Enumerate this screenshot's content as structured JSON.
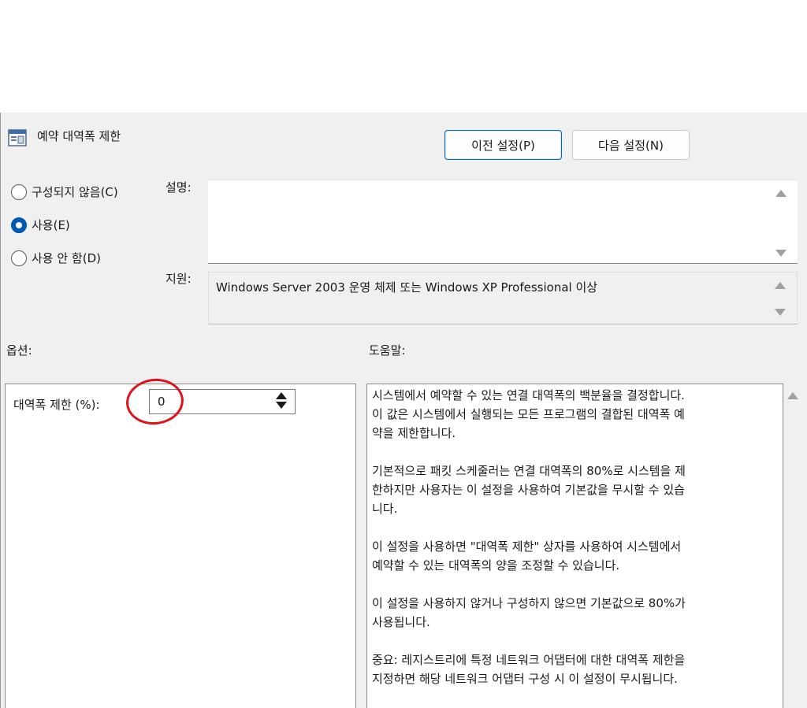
{
  "window": {
    "title": "예약 대역폭 제한"
  },
  "nav": {
    "prev_label": "이전 설정(P)",
    "next_label": "다음 설정(N)"
  },
  "state": {
    "options": [
      {
        "label": "구성되지 않음(C)",
        "checked": false
      },
      {
        "label": "사용(E)",
        "checked": true
      },
      {
        "label": "사용 안 함(D)",
        "checked": false
      }
    ]
  },
  "description": {
    "label": "설명:",
    "value": ""
  },
  "support": {
    "label": "지원:",
    "value": "Windows Server 2003 운영 체제 또는 Windows XP Professional 이상"
  },
  "options_panel": {
    "header": "옵션:",
    "bandwidth_label": "대역폭 제한 (%):",
    "bandwidth_value": "0"
  },
  "help_panel": {
    "header": "도움말:",
    "paragraphs": [
      "시스템에서 예약할 수 있는 연결 대역폭의 백분율을 결정합니다.\n이 값은 시스템에서 실행되는 모든 프로그램의 결합된 대역폭 예\n약을 제한합니다.",
      "기본적으로 패킷 스케줄러는 연결 대역폭의 80%로 시스템을 제\n한하지만 사용자는 이 설정을 사용하여 기본값을 무시할 수 있습\n니다.",
      "이 설정을 사용하면 \"대역폭 제한\" 상자를 사용하여 시스템에서\n예약할 수 있는 대역폭의 양을 조정할 수 있습니다.",
      "이 설정을 사용하지 않거나 구성하지 않으면 기본값으로 80%가\n사용됩니다.",
      "중요: 레지스트리에 특정 네트워크 어댑터에 대한 대역폭 제한을\n지정하면 해당 네트워크 어댑터 구성 시 이 설정이 무시됩니다."
    ]
  },
  "colors": {
    "accent": "#0059b3",
    "annotation": "#e0131b",
    "dialog_bg": "#f0f0f0"
  },
  "icons": {
    "title": "policy-setting-icon"
  }
}
